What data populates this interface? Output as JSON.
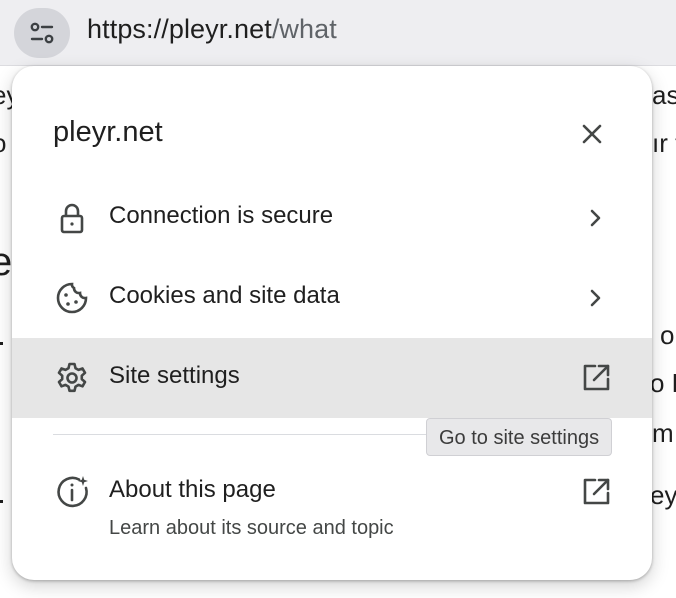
{
  "address_bar": {
    "url_prefix": "https://pleyr.net",
    "url_path": "/what",
    "site_info_icon": "tune-icon"
  },
  "background_fragments": [
    {
      "name": "bg-text-left-1",
      "text": "ey"
    },
    {
      "name": "bg-text-left-2",
      "text": "o"
    },
    {
      "name": "bg-text-left-3",
      "text": "e"
    },
    {
      "name": "bg-text-right-1",
      "text": "as"
    },
    {
      "name": "bg-text-right-2",
      "text": "ır t"
    },
    {
      "name": "bg-text-right-3",
      "text": "o"
    },
    {
      "name": "bg-text-right-4",
      "text": "o F"
    },
    {
      "name": "bg-text-right-5",
      "text": "m"
    },
    {
      "name": "bg-text-right-6",
      "text": "ey"
    }
  ],
  "popup": {
    "title": "pleyr.net",
    "close_icon": "close-icon",
    "items": [
      {
        "label": "Connection is secure",
        "icon": "lock-icon",
        "end_icon": "chevron-right-icon"
      },
      {
        "label": "Cookies and site data",
        "icon": "cookie-icon",
        "end_icon": "chevron-right-icon"
      },
      {
        "label": "Site settings",
        "icon": "gear-icon",
        "end_icon": "open-in-new-icon"
      },
      {
        "label": "About this page",
        "icon": "info-sparkle-icon",
        "end_icon": "open-in-new-icon",
        "sublabel": "Learn about its source and topic"
      }
    ]
  },
  "tooltip": {
    "text": "Go to site settings"
  },
  "colors": {
    "highlight": "#e6e6e6",
    "icon": "#444746",
    "toolbar": "#eeeef1"
  }
}
